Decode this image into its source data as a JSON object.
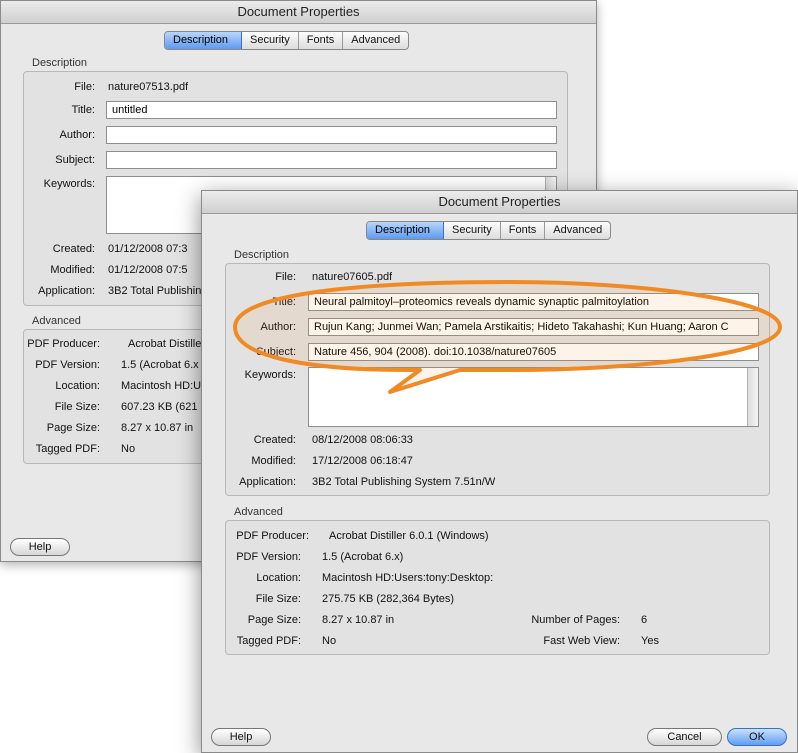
{
  "window_title": "Document Properties",
  "tabs": [
    "Description",
    "Security",
    "Fonts",
    "Advanced"
  ],
  "labels": {
    "description": "Description",
    "advanced": "Advanced",
    "file": "File:",
    "title": "Title:",
    "author": "Author:",
    "subject": "Subject:",
    "keywords": "Keywords:",
    "created": "Created:",
    "modified": "Modified:",
    "application": "Application:",
    "pdf_producer": "PDF Producer:",
    "pdf_version": "PDF Version:",
    "location": "Location:",
    "file_size": "File Size:",
    "page_size": "Page Size:",
    "tagged_pdf": "Tagged PDF:",
    "number_of_pages": "Number of Pages:",
    "fast_web_view": "Fast Web View:"
  },
  "back": {
    "file": "nature07513.pdf",
    "title": "untitled",
    "author": "",
    "subject": "",
    "keywords": "",
    "created": "01/12/2008 07:3",
    "modified": "01/12/2008 07:5",
    "application": "3B2 Total Publishing",
    "pdf_producer": "Acrobat Distille",
    "pdf_version": "1.5 (Acrobat 6.x",
    "location": "Macintosh HD:U",
    "file_size": "607.23 KB (621",
    "page_size": "8.27 x 10.87 in",
    "tagged_pdf": "No",
    "help": "Help"
  },
  "front": {
    "file": "nature07605.pdf",
    "title": "Neural palmitoyl–proteomics reveals dynamic synaptic palmitoylation",
    "author": "Rujun Kang; Junmei Wan; Pamela Arstikaitis; Hideto Takahashi; Kun Huang; Aaron C",
    "subject": "Nature 456, 904 (2008). doi:10.1038/nature07605",
    "keywords": "",
    "created": "08/12/2008 08:06:33",
    "modified": "17/12/2008 06:18:47",
    "application": "3B2 Total Publishing System 7.51n/W",
    "pdf_producer": "Acrobat Distiller 6.0.1 (Windows)",
    "pdf_version": "1.5 (Acrobat 6.x)",
    "location": "Macintosh HD:Users:tony:Desktop:",
    "file_size": "275.75 KB (282,364 Bytes)",
    "page_size": "8.27 x 10.87 in",
    "tagged_pdf": "No",
    "number_of_pages": "6",
    "fast_web_view": "Yes",
    "help": "Help",
    "cancel": "Cancel",
    "ok": "OK"
  },
  "colors": {
    "callout": "#f08a24",
    "selected_tab": "#5d9af0",
    "window_bg": "#e8e8e8"
  }
}
